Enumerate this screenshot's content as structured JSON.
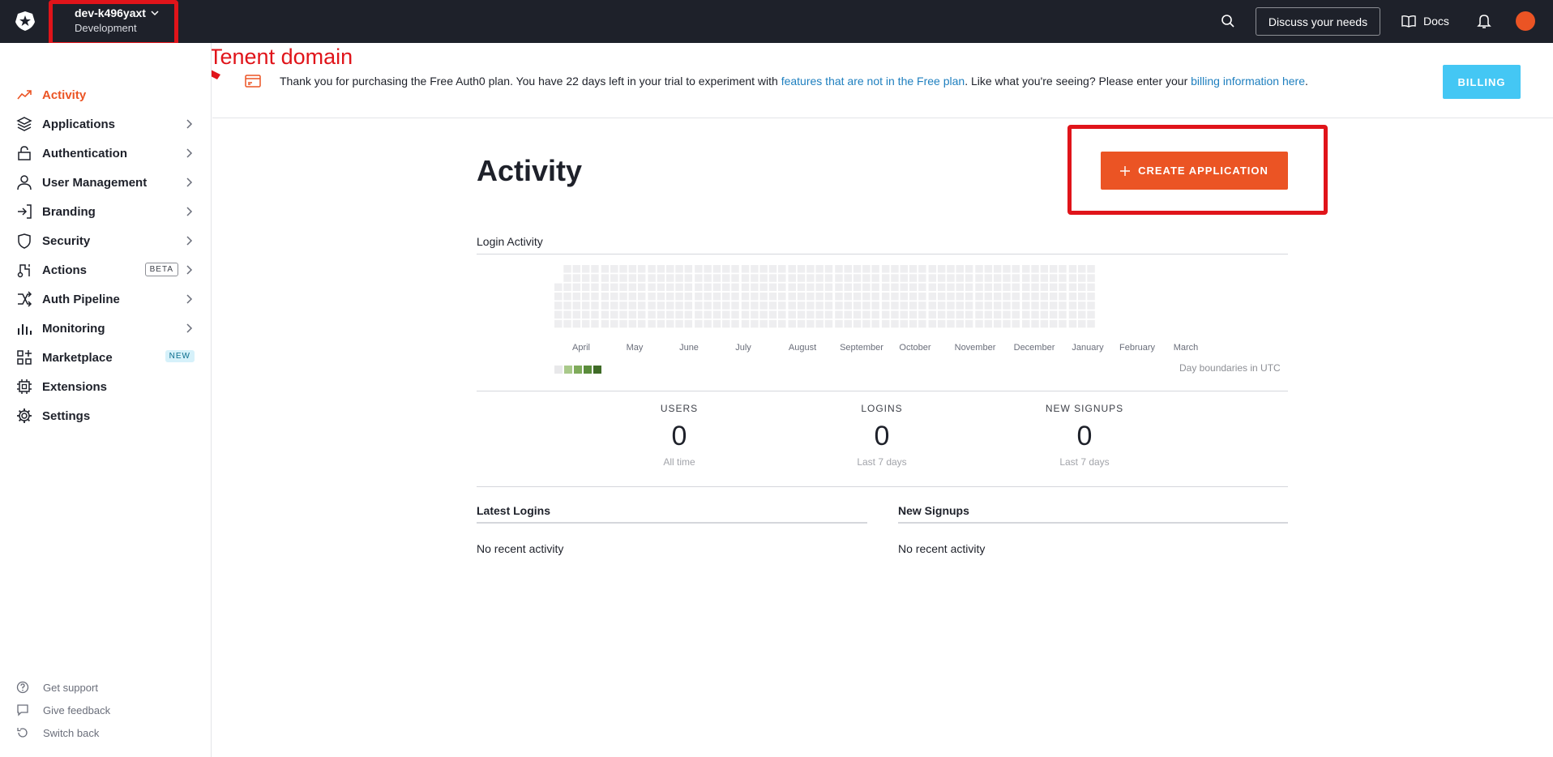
{
  "topbar": {
    "tenant_name": "dev-k496yaxt",
    "tenant_env": "Development",
    "discuss_label": "Discuss your needs",
    "docs_label": "Docs"
  },
  "annotation": {
    "label": "Tenent domain",
    "color": "#e0141a"
  },
  "sidebar": {
    "items": [
      {
        "label": "Activity",
        "icon": "activity-icon",
        "active": true
      },
      {
        "label": "Applications",
        "icon": "layers-icon"
      },
      {
        "label": "Authentication",
        "icon": "lock-icon"
      },
      {
        "label": "User Management",
        "icon": "user-icon"
      },
      {
        "label": "Branding",
        "icon": "branding-icon"
      },
      {
        "label": "Security",
        "icon": "shield-icon"
      },
      {
        "label": "Actions",
        "icon": "actions-icon",
        "badge": "BETA"
      },
      {
        "label": "Auth Pipeline",
        "icon": "pipeline-icon"
      },
      {
        "label": "Monitoring",
        "icon": "bar-chart-icon"
      },
      {
        "label": "Marketplace",
        "icon": "marketplace-icon",
        "badge": "NEW"
      },
      {
        "label": "Extensions",
        "icon": "chip-icon"
      },
      {
        "label": "Settings",
        "icon": "gear-icon"
      }
    ],
    "footer": [
      {
        "label": "Get support",
        "icon": "help-icon"
      },
      {
        "label": "Give feedback",
        "icon": "chat-icon"
      },
      {
        "label": "Switch back",
        "icon": "undo-icon"
      }
    ]
  },
  "banner": {
    "text_before": "Thank you for purchasing the Free Auth0 plan. You have 22 days left in your trial to experiment with ",
    "link1": "features that are not in the Free plan",
    "text_middle": ". Like what you're seeing? Please enter your ",
    "link2": "billing information here",
    "text_after": ".",
    "billing_label": "BILLING"
  },
  "main": {
    "title": "Activity",
    "create_label": "CREATE APPLICATION",
    "login_activity_title": "Login Activity",
    "months": [
      "April",
      "May",
      "June",
      "July",
      "August",
      "September",
      "October",
      "November",
      "December",
      "January",
      "February",
      "March"
    ],
    "utc_note": "Day boundaries in UTC",
    "stats": [
      {
        "label": "USERS",
        "value": "0",
        "sub": "All time"
      },
      {
        "label": "LOGINS",
        "value": "0",
        "sub": "Last 7 days"
      },
      {
        "label": "NEW SIGNUPS",
        "value": "0",
        "sub": "Last 7 days"
      }
    ],
    "latest_logins_title": "Latest Logins",
    "new_signups_title": "New Signups",
    "latest_logins_empty": "No recent activity",
    "new_signups_empty": "No recent activity"
  },
  "colors": {
    "accent": "#eb5424",
    "topbar": "#1e212a",
    "billing": "#44c7f4",
    "link": "#1e7fbf",
    "legend": [
      "#e8e8ea",
      "#a9c98a",
      "#7fab5b",
      "#5a8c3b",
      "#3f6b27"
    ]
  }
}
